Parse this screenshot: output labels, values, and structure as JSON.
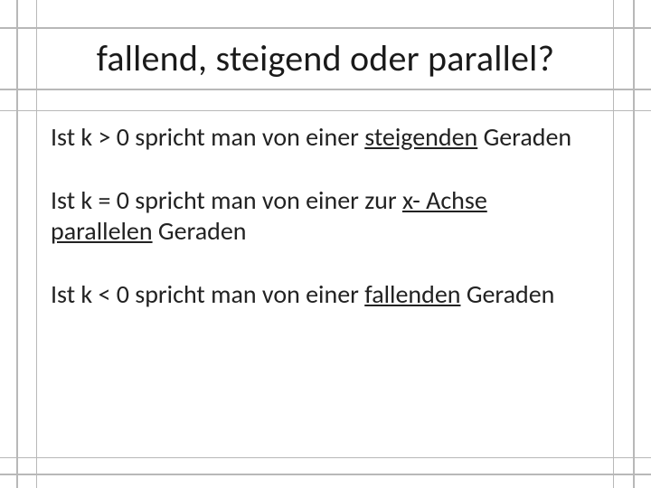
{
  "slide": {
    "title": "fallend, steigend oder parallel?",
    "p1a": "Ist k > 0 spricht man von einer ",
    "p1u": "steigenden",
    "p1b": " Geraden",
    "p2a": "Ist k = 0 spricht man von einer zur ",
    "p2u": "x- Achse parallelen",
    "p2b": " Geraden",
    "p3a": "Ist k < 0 spricht man von einer ",
    "p3u": "fallenden",
    "p3b": " Geraden"
  }
}
